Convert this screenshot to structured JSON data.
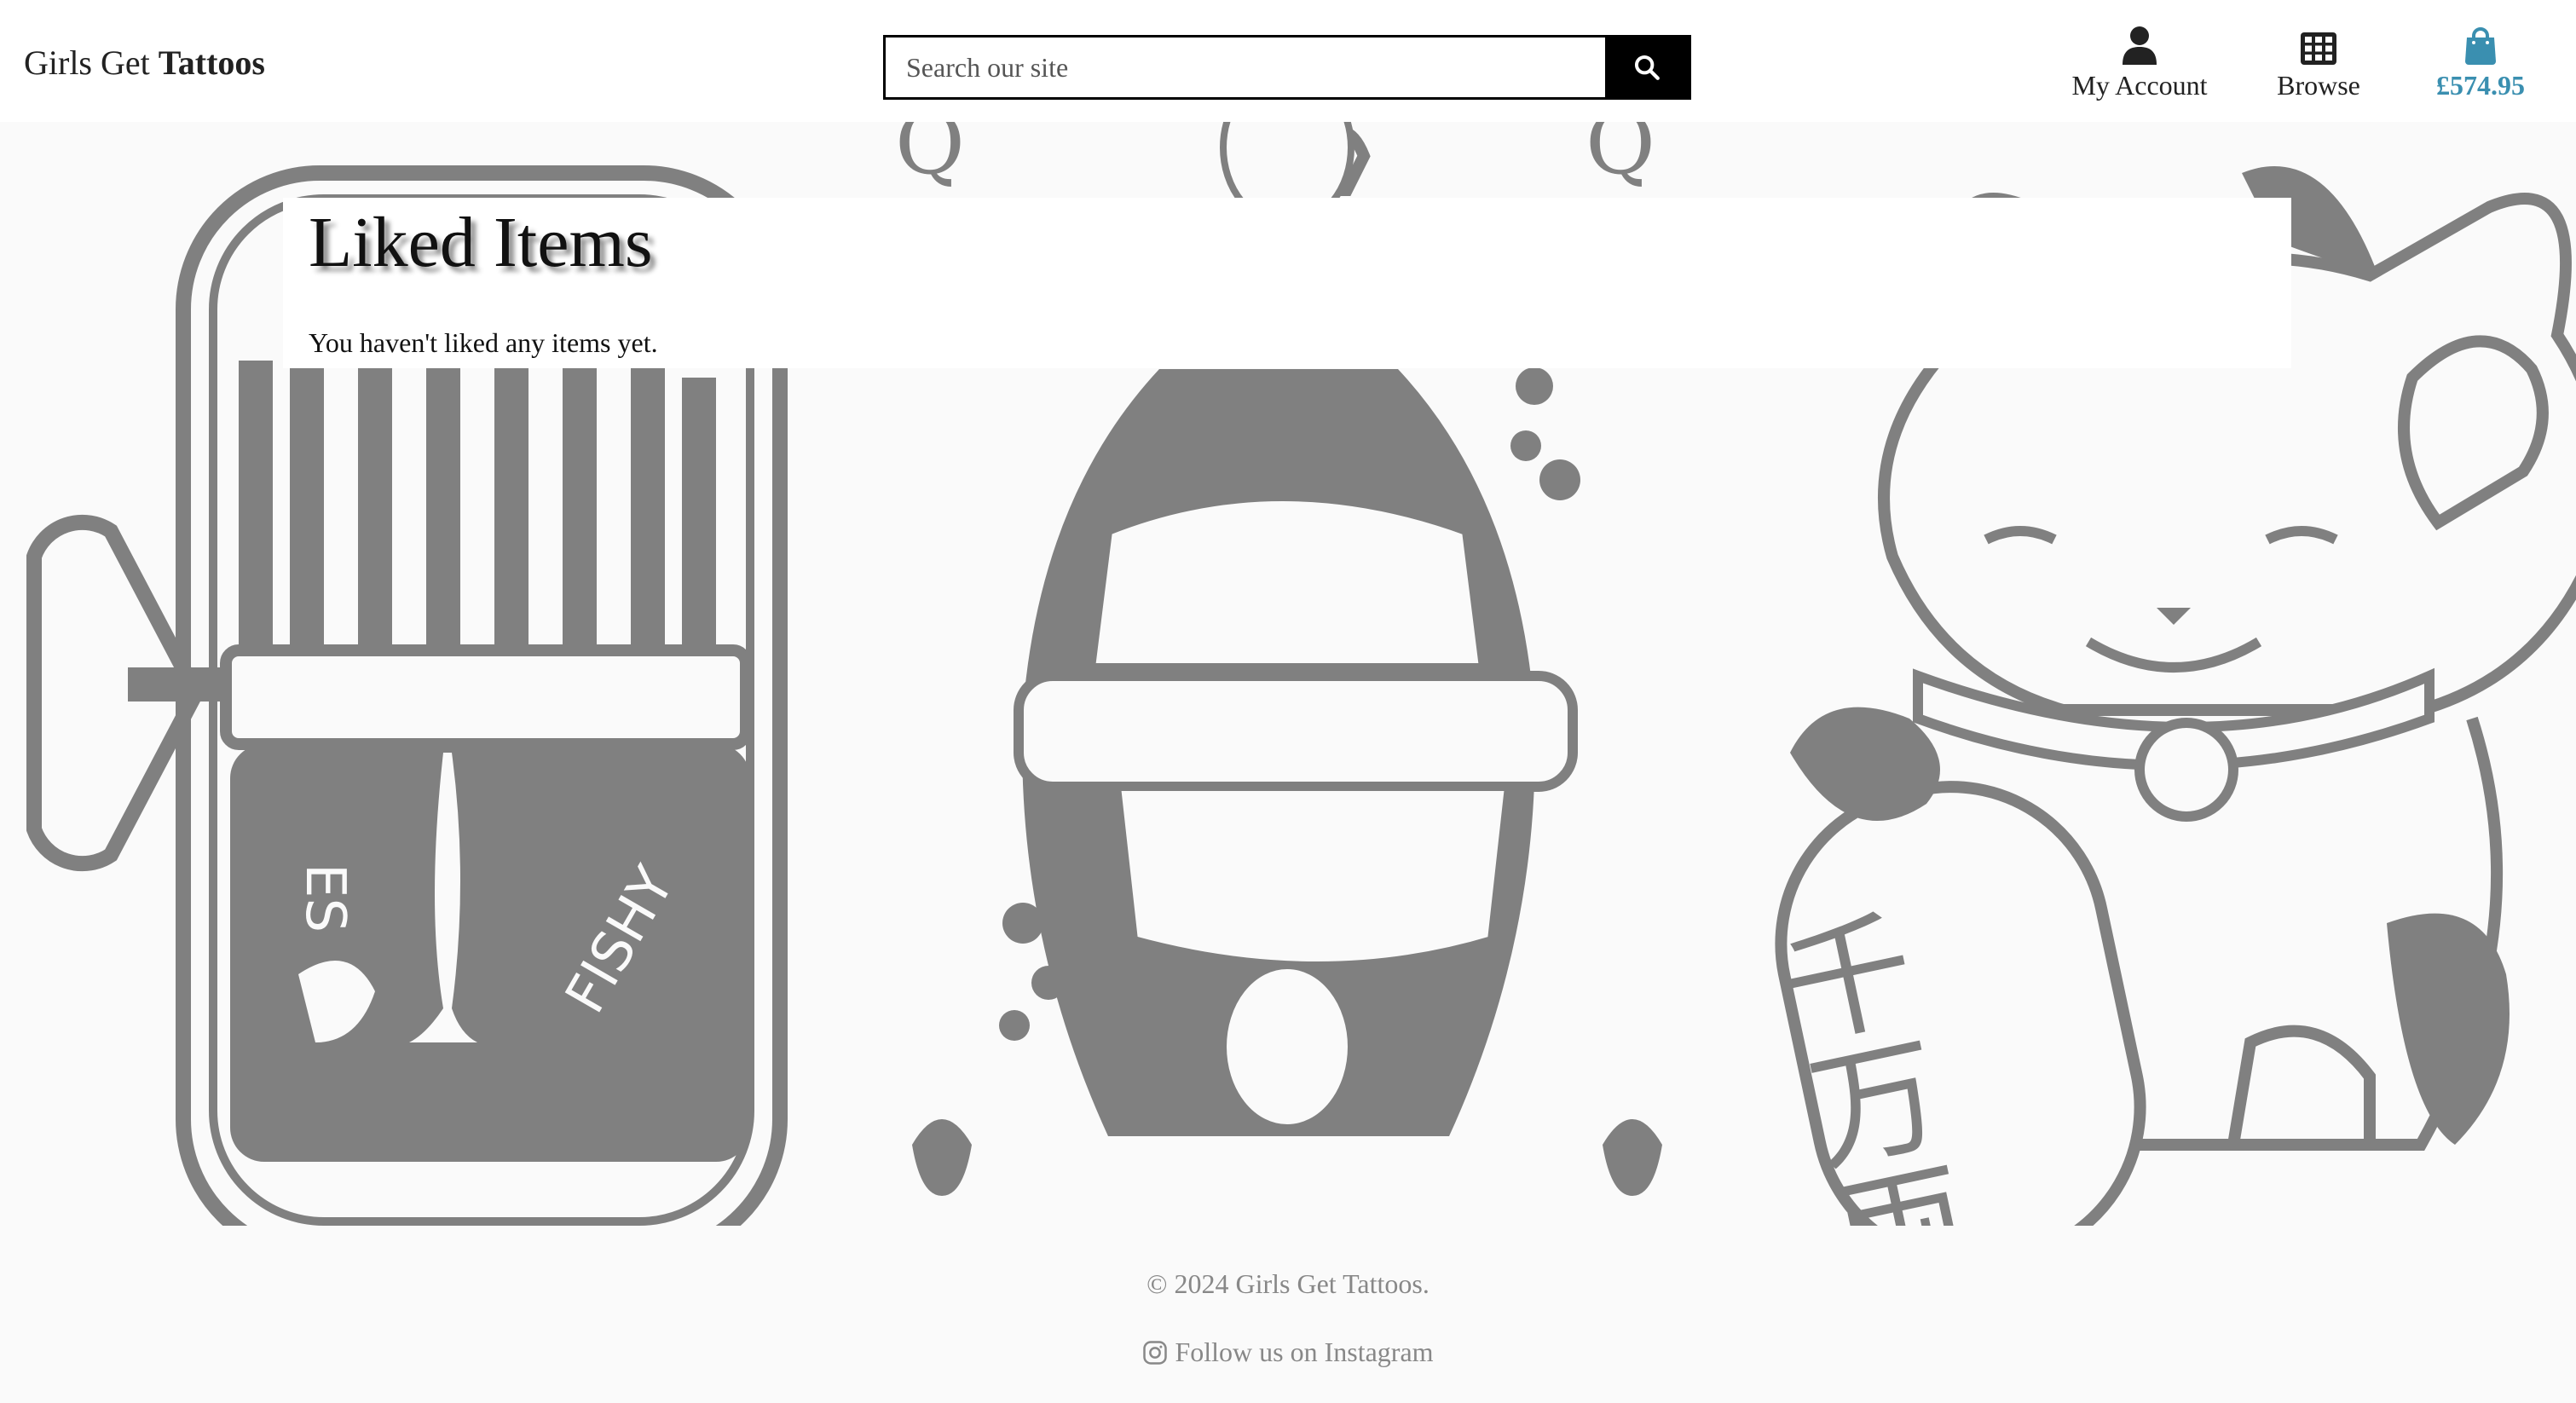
{
  "header": {
    "brand_regular": "Girls Get",
    "brand_bold": "Tattoos",
    "search_placeholder": "Search our site",
    "account_label": "My Account",
    "browse_label": "Browse",
    "bag_total": "£574.95",
    "accent_color": "#3a8fb0"
  },
  "main": {
    "title": "Liked Items",
    "empty_message": "You haven't liked any items yet."
  },
  "background_art": {
    "sardine_can_text_1": "ES",
    "sardine_can_text_2": "FISHY",
    "card_letter": "Q",
    "cat_charm_text": "千万両"
  },
  "footer": {
    "copyright": "© 2024 Girls Get Tattoos.",
    "instagram_label": "Follow us on Instagram",
    "text_color": "#888888"
  }
}
